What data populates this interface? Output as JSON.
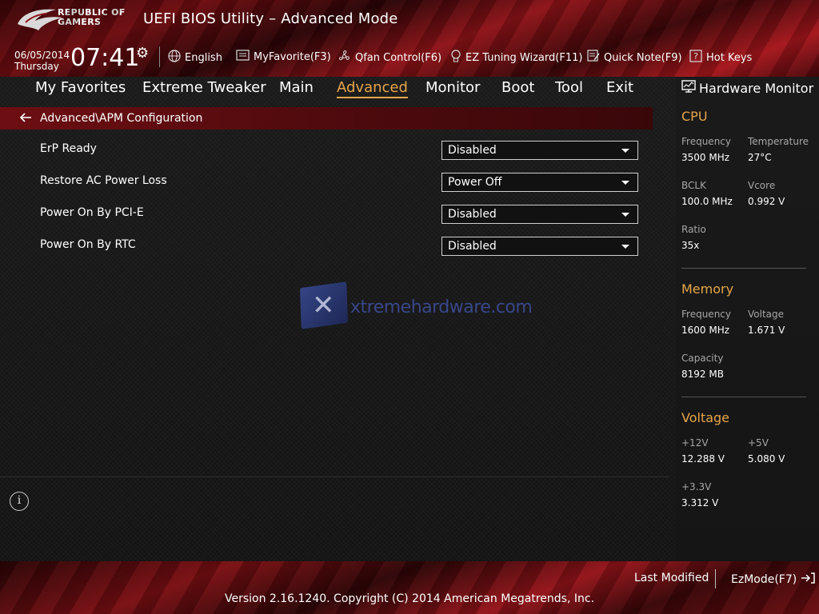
{
  "header": {
    "logo_line1": "REPUBLIC OF",
    "logo_line2": "GAMERS",
    "title": "UEFI BIOS Utility – Advanced Mode",
    "date": "06/05/2014",
    "day": "Thursday",
    "time": "07:41"
  },
  "toolbar": {
    "language": "English",
    "myfavorite": "MyFavorite(F3)",
    "qfan": "Qfan Control(F6)",
    "ez_tuning": "EZ Tuning Wizard(F11)",
    "quick_note": "Quick Note(F9)",
    "hot_keys": "Hot Keys"
  },
  "tabs": [
    "My Favorites",
    "Extreme Tweaker",
    "Main",
    "Advanced",
    "Monitor",
    "Boot",
    "Tool",
    "Exit"
  ],
  "active_tab": "Advanced",
  "breadcrumb": "Advanced\\APM Configuration",
  "settings": [
    {
      "label": "ErP Ready",
      "value": "Disabled"
    },
    {
      "label": "Restore AC Power Loss",
      "value": "Power Off"
    },
    {
      "label": "Power On By PCI-E",
      "value": "Disabled"
    },
    {
      "label": "Power On By RTC",
      "value": "Disabled"
    }
  ],
  "watermark": {
    "text": "xtremehardware.com"
  },
  "hardware_monitor": {
    "title": "Hardware Monitor",
    "cpu": {
      "heading": "CPU",
      "frequency_label": "Frequency",
      "frequency": "3500 MHz",
      "temperature_label": "Temperature",
      "temperature": "27°C",
      "bclk_label": "BCLK",
      "bclk": "100.0 MHz",
      "vcore_label": "Vcore",
      "vcore": "0.992 V",
      "ratio_label": "Ratio",
      "ratio": "35x"
    },
    "memory": {
      "heading": "Memory",
      "frequency_label": "Frequency",
      "frequency": "1600 MHz",
      "voltage_label": "Voltage",
      "voltage": "1.671 V",
      "capacity_label": "Capacity",
      "capacity": "8192 MB"
    },
    "voltage": {
      "heading": "Voltage",
      "v12_label": "+12V",
      "v12": "12.288 V",
      "v5_label": "+5V",
      "v5": "5.080 V",
      "v33_label": "+3.3V",
      "v33": "3.312 V"
    }
  },
  "footer": {
    "last_modified": "Last Modified",
    "ezmode": "EzMode(F7)",
    "copyright": "Version 2.16.1240. Copyright (C) 2014 American Megatrends, Inc."
  },
  "colors": {
    "accent": "#e6a64a",
    "brand_red": "#8e1318"
  }
}
